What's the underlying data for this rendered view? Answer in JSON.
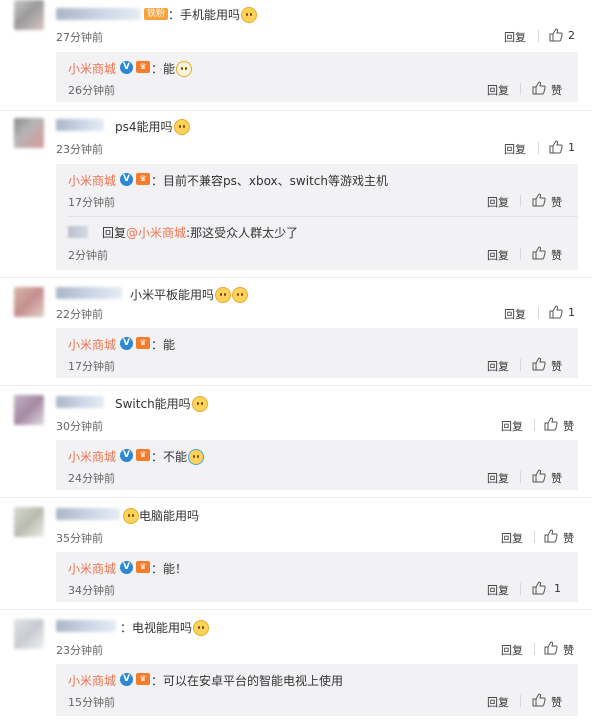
{
  "actions": {
    "reply": "回复",
    "like": "赞"
  },
  "comments": [
    {
      "fan_badge": "铁粉",
      "text": "：手机能用吗",
      "emoji": "doge-emoji",
      "time": "27分钟前",
      "likes": "2",
      "replies": [
        {
          "author": "小米商城",
          "text": "：能",
          "emoji": "glasses-emoji",
          "time": "26分钟前",
          "likes": "赞"
        }
      ]
    },
    {
      "text": "ps4能用吗",
      "emoji": "doge-emoji",
      "time": "23分钟前",
      "likes": "1",
      "replies": [
        {
          "author": "小米商城",
          "text": "：目前不兼容ps、xbox、switch等游戏主机",
          "time": "17分钟前",
          "likes": "赞"
        }
      ],
      "nested": {
        "prefix": "回复",
        "mention": "@小米商城",
        "text": ":那这受众人群太少了",
        "time": "2分钟前",
        "likes": "赞"
      }
    },
    {
      "text": "小米平板能用吗",
      "emoji": "doge-emoji",
      "time": "22分钟前",
      "likes": "1",
      "replies": [
        {
          "author": "小米商城",
          "text": "：能",
          "time": "17分钟前",
          "likes": "赞"
        }
      ]
    },
    {
      "text": "Switch能用吗",
      "emoji": "doge-emoji",
      "time": "30分钟前",
      "likes": "赞",
      "replies": [
        {
          "author": "小米商城",
          "text": "：不能",
          "emoji": "crying-emoji",
          "time": "24分钟前",
          "likes": "赞"
        }
      ]
    },
    {
      "text": "电脑能用吗",
      "emoji_prefix": "doge-emoji",
      "time": "35分钟前",
      "likes": "赞",
      "replies": [
        {
          "author": "小米商城",
          "text": "：能！",
          "time": "34分钟前",
          "likes": "1"
        }
      ]
    },
    {
      "text": "：电视能用吗",
      "emoji": "tongue-emoji",
      "time": "23分钟前",
      "likes": "赞",
      "replies": [
        {
          "author": "小米商城",
          "text": "：可以在安卓平台的智能电视上使用",
          "time": "15分钟前",
          "likes": "赞"
        }
      ]
    }
  ]
}
